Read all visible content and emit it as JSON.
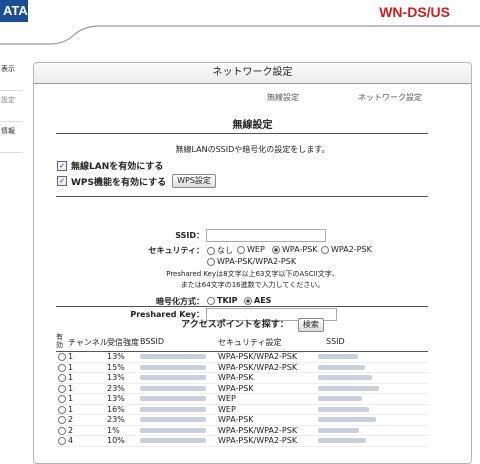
{
  "header": {
    "brand": "ATA",
    "model": "WN-DS/US"
  },
  "nav": [
    {
      "label": "表示"
    },
    {
      "label": "設定"
    },
    {
      "label": "情報"
    }
  ],
  "panel": {
    "title": "ネットワーク設定",
    "subtabs": [
      "無線設定",
      "ネットワーク設定"
    ],
    "section_title": "無線設定",
    "description": "無線LANのSSIDや暗号化の設定をします。",
    "enable_wlan": "無線LANを有効にする",
    "enable_wps": "WPS機能を有効にする",
    "wps_button": "WPS設定",
    "ssid_label": "SSID：",
    "security_label": "セキュリティ：",
    "security_options": [
      "なし",
      "WEP",
      "WPA-PSK",
      "WPA2-PSK",
      "WPA-PSK/WPA2-PSK"
    ],
    "security_selected": "WPA-PSK",
    "note1": "Preshared Keyは8文字以上63文字以下のASCII文字、",
    "note2": "または64文字の16進数で入力してください。",
    "encryption_label": "暗号化方式：",
    "encryption_options": [
      "TKIP",
      "AES"
    ],
    "encryption_selected": "AES",
    "preshared_label": "Preshared Key："
  },
  "ap_search": {
    "title": "アクセスポイントを探す：",
    "button": "検索",
    "columns": [
      "有効",
      "チャンネル",
      "受信強度",
      "BSSID",
      "セキュリティ設定",
      "SSID"
    ],
    "rows": [
      {
        "channel": "1",
        "strength": "13%",
        "security": "WPA-PSK/WPA2-PSK"
      },
      {
        "channel": "1",
        "strength": "15%",
        "security": "WPA-PSK/WPA2-PSK"
      },
      {
        "channel": "1",
        "strength": "13%",
        "security": "WPA-PSK"
      },
      {
        "channel": "1",
        "strength": "23%",
        "security": "WPA-PSK"
      },
      {
        "channel": "1",
        "strength": "13%",
        "security": "WEP"
      },
      {
        "channel": "1",
        "strength": "16%",
        "security": "WEP"
      },
      {
        "channel": "2",
        "strength": "23%",
        "security": "WPA-PSK"
      },
      {
        "channel": "2",
        "strength": "1%",
        "security": "WPA-PSK/WPA2-PSK"
      },
      {
        "channel": "4",
        "strength": "10%",
        "security": "WPA-PSK/WPA2-PSK"
      }
    ]
  }
}
